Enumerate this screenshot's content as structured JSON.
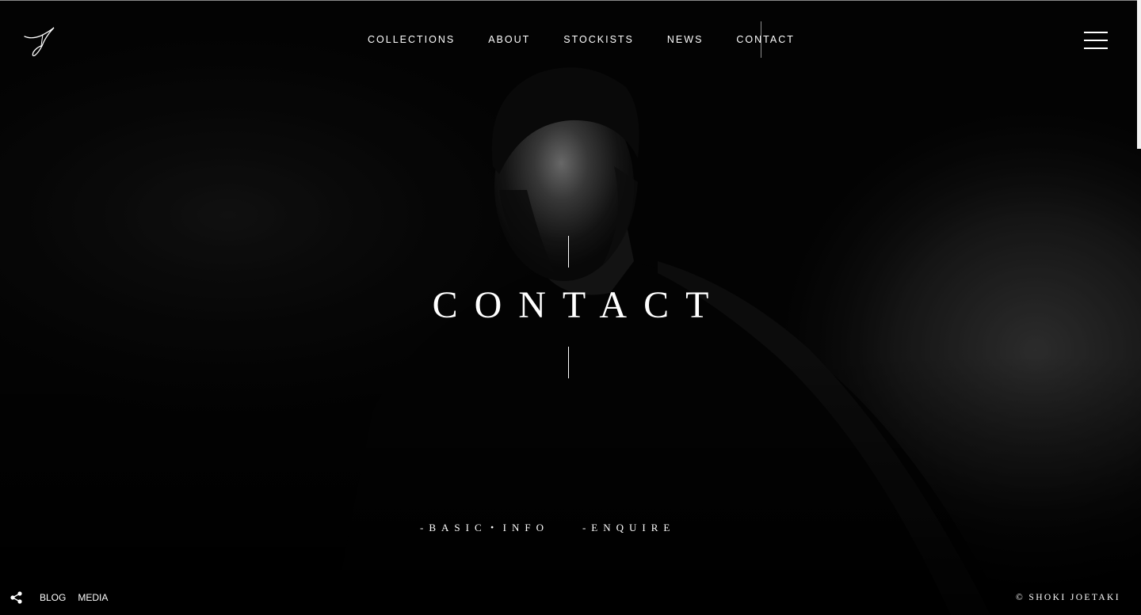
{
  "header": {
    "logo_icon": "signature-logo-icon",
    "nav": [
      {
        "label": "COLLECTIONS"
      },
      {
        "label": "ABOUT"
      },
      {
        "label": "STOCKISTS"
      },
      {
        "label": "NEWS"
      },
      {
        "label": "CONTACT",
        "active": true
      }
    ],
    "menu_icon": "hamburger-menu-icon"
  },
  "hero": {
    "title": "CONTACT",
    "subnav": [
      {
        "label": "-BASIC・INFO"
      },
      {
        "label": "-ENQUIRE"
      }
    ]
  },
  "footer": {
    "share_icon": "share-icon",
    "links": [
      {
        "label": "BLOG"
      },
      {
        "label": "MEDIA"
      }
    ],
    "copyright": "© SHOKI JOETAKI"
  },
  "colors": {
    "background": "#030303",
    "text": "#ffffff",
    "accent_line": "#8e8e8e"
  }
}
